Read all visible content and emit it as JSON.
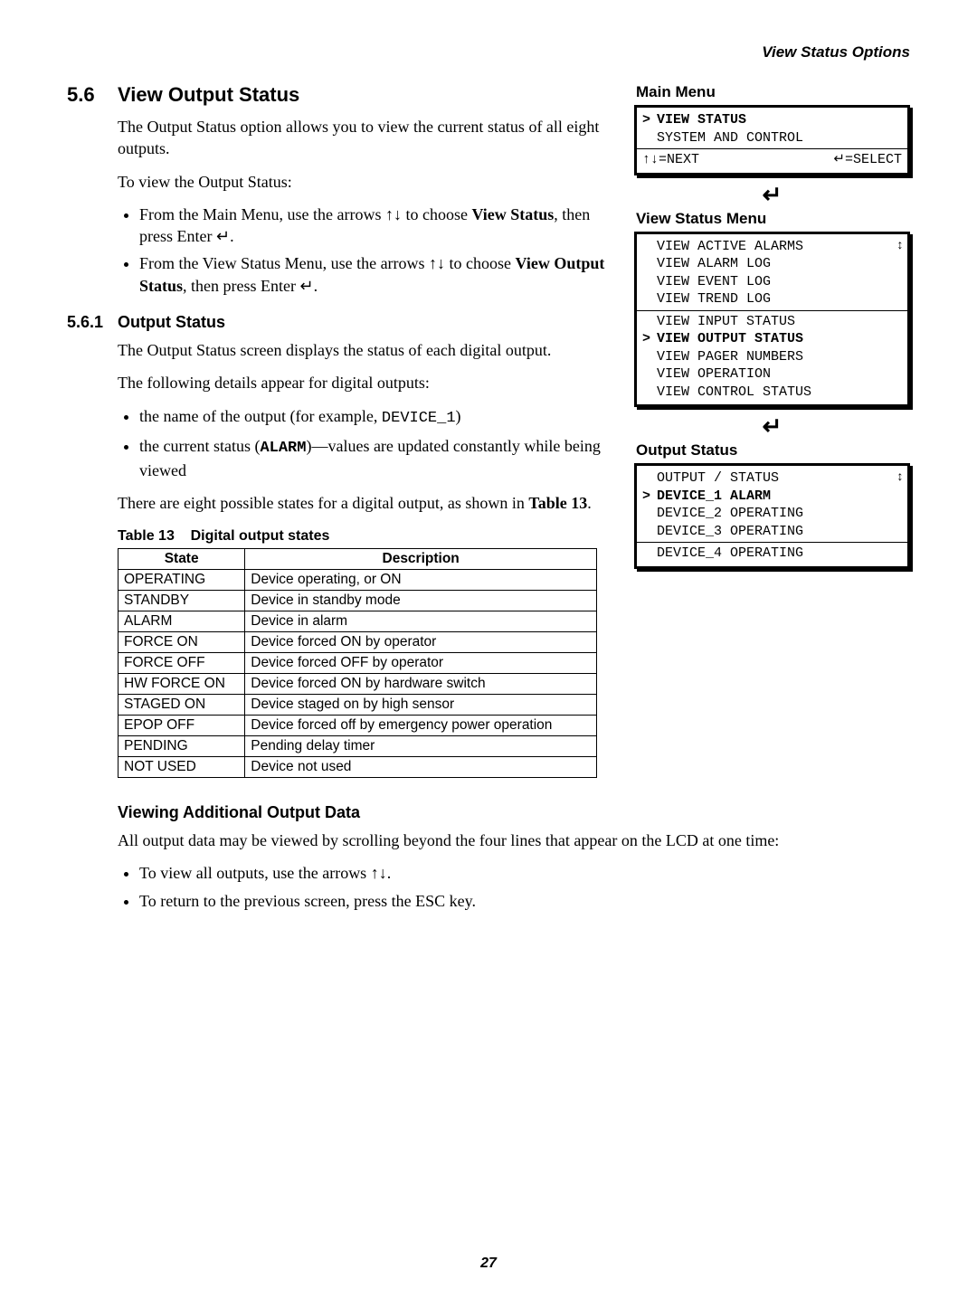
{
  "header": {
    "running_head": "View Status Options"
  },
  "section": {
    "number": "5.6",
    "title": "View Output Status",
    "intro": "The Output Status option allows you to view the current status of all eight outputs.",
    "to_view": "To view the Output Status:",
    "step1_pre": "From the Main Menu, use the arrows ",
    "arrows": "↑↓",
    "step1_mid": " to choose ",
    "step1_bold": "View Status",
    "step1_suf": ", then press Enter ",
    "enter_sym": "↵",
    "step1_end": ".",
    "step2_pre": "From the View Status Menu, use the arrows ",
    "step2_mid": " to choose ",
    "step2_bold": "View Output Status",
    "step2_suf": ", then press Enter ",
    "step2_end": "."
  },
  "subsection": {
    "number": "5.6.1",
    "title": "Output Status",
    "p1": "The Output Status screen displays the status of each digital output.",
    "p2": "The following details appear for digital outputs:",
    "b1_pre": "the name of the output (for example, ",
    "b1_mono": "DEVICE_1",
    "b1_suf": ")",
    "b2_pre": "the current status (",
    "b2_bold": "ALARM",
    "b2_suf": ")—values are updated constantly while being viewed",
    "p3_pre": "There are eight possible states for a digital output, as shown in ",
    "p3_bold": "Table 13",
    "p3_suf": "."
  },
  "table": {
    "caption_label": "Table 13",
    "caption_title": "Digital output states",
    "col_state": "State",
    "col_desc": "Description",
    "rows": [
      {
        "s": "OPERATING",
        "d": "Device operating, or ON"
      },
      {
        "s": "STANDBY",
        "d": "Device in standby mode"
      },
      {
        "s": "ALARM",
        "d": "Device in alarm"
      },
      {
        "s": "FORCE ON",
        "d": "Device forced ON by operator"
      },
      {
        "s": "FORCE OFF",
        "d": "Device forced OFF by operator"
      },
      {
        "s": "HW FORCE ON",
        "d": "Device forced ON by hardware switch"
      },
      {
        "s": "STAGED ON",
        "d": "Device staged on by high sensor"
      },
      {
        "s": "EPOP OFF",
        "d": "Device forced off by emergency power operation"
      },
      {
        "s": "PENDING",
        "d": "Pending delay timer"
      },
      {
        "s": "NOT USED",
        "d": "Device not used"
      }
    ]
  },
  "additional": {
    "title": "Viewing Additional Output Data",
    "intro": "All output data may be viewed by scrolling beyond the four lines that appear on the LCD at one time:",
    "b1_pre": "To view all outputs, use the arrows ",
    "b1_suf": ".",
    "b2": "To return to the previous screen, press the ESC key."
  },
  "side": {
    "main_menu_label": "Main Menu",
    "main_menu": {
      "sel_prefix": "> ",
      "line1": "VIEW STATUS",
      "line2": "SYSTEM AND CONTROL",
      "nav_left": "↑↓=NEXT",
      "nav_right": "↵=SELECT"
    },
    "enter_glyph": "↵",
    "view_status_label": "View Status Menu",
    "view_status": {
      "scroll_glyph": "↕",
      "l1": "VIEW ACTIVE ALARMS",
      "l2": "VIEW ALARM LOG",
      "l3": "VIEW EVENT LOG",
      "l4": "VIEW TREND LOG",
      "l5": "VIEW INPUT STATUS",
      "l6": "VIEW OUTPUT STATUS",
      "l7": "VIEW PAGER NUMBERS",
      "l8": "VIEW OPERATION",
      "l9": "VIEW CONTROL STATUS"
    },
    "output_status_label": "Output Status",
    "output_status": {
      "scroll_glyph": "↕",
      "header": "OUTPUT / STATUS",
      "r1": "DEVICE_1 ALARM",
      "r2": "DEVICE_2 OPERATING",
      "r3": "DEVICE_3 OPERATING",
      "r4": "DEVICE_4 OPERATING"
    }
  },
  "footer": {
    "page": "27"
  }
}
